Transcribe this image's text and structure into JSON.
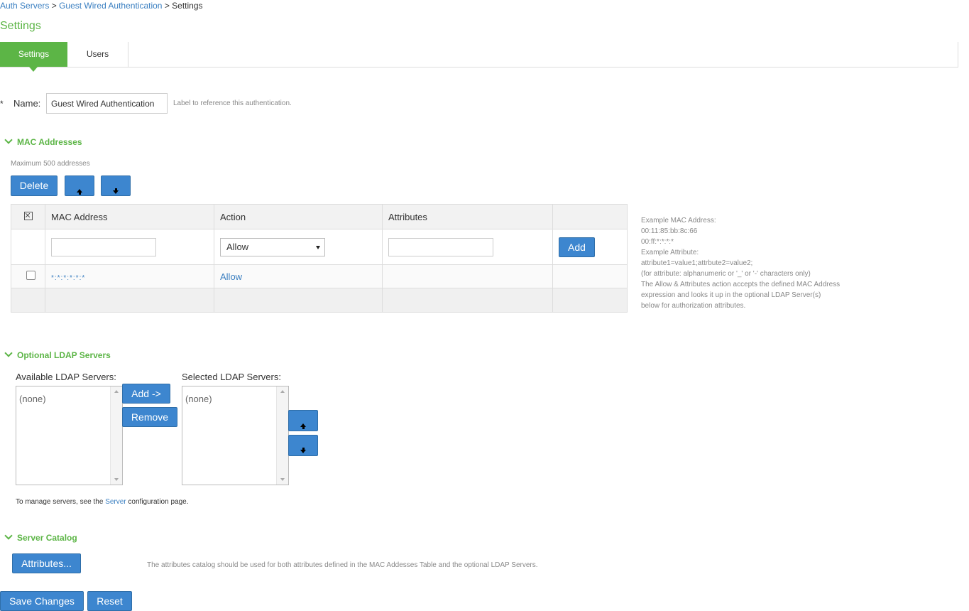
{
  "breadcrumb": {
    "link1": "Auth Servers",
    "sep": " > ",
    "link2": "Guest Wired Authentication",
    "current": "Settings"
  },
  "page": {
    "title": "Settings"
  },
  "tabs": [
    {
      "label": "Settings"
    },
    {
      "label": "Users"
    }
  ],
  "name_field": {
    "required": "*",
    "label": "Name:",
    "value": "Guest Wired Authentication",
    "hint": "Label to reference this authentication."
  },
  "mac_section": {
    "title": "MAC Addresses",
    "max_note": "Maximum 500 addresses",
    "delete_label": "Delete",
    "columns": [
      "MAC Address",
      "Action",
      "Attributes"
    ],
    "new_row": {
      "action_selected": "Allow",
      "add_label": "Add"
    },
    "rows": [
      {
        "mac": "*:*:*:*:*:*",
        "action": "Allow",
        "attributes": ""
      }
    ],
    "help": [
      "Example MAC Address:",
      "00:11:85:bb:8c:66",
      "00:ff:*:*:*:*",
      "Example Attribute:",
      "attribute1=value1;attrbute2=value2;",
      "(for attribute: alphanumeric or '_' or '-' characters only)",
      "The Allow & Attributes action accepts the defined MAC Address",
      "expression and looks it up in the optional LDAP Server(s)",
      "below for authorization attributes."
    ]
  },
  "ldap_section": {
    "title": "Optional LDAP Servers",
    "available_label": "Available LDAP Servers:",
    "selected_label": "Selected LDAP Servers:",
    "available_items": [
      "(none)"
    ],
    "selected_items": [
      "(none)"
    ],
    "add_label": "Add ->",
    "remove_label": "Remove",
    "manage_prefix": "To manage servers, see the ",
    "manage_link": "Server",
    "manage_suffix": " configuration page."
  },
  "catalog_section": {
    "title": "Server Catalog",
    "attributes_label": "Attributes...",
    "note": "The attributes catalog should be used for both attributes defined in the MAC Addesses Table and the optional LDAP Servers."
  },
  "footer": {
    "save_label": "Save Changes",
    "reset_label": "Reset"
  },
  "colors": {
    "accent_green": "#5cb546",
    "button_blue": "#3d86cf",
    "link_blue": "#3a7fc1"
  },
  "icons": [
    "arrow-up-icon",
    "arrow-down-icon",
    "chevron-down-icon",
    "select-all-checkbox-icon"
  ]
}
